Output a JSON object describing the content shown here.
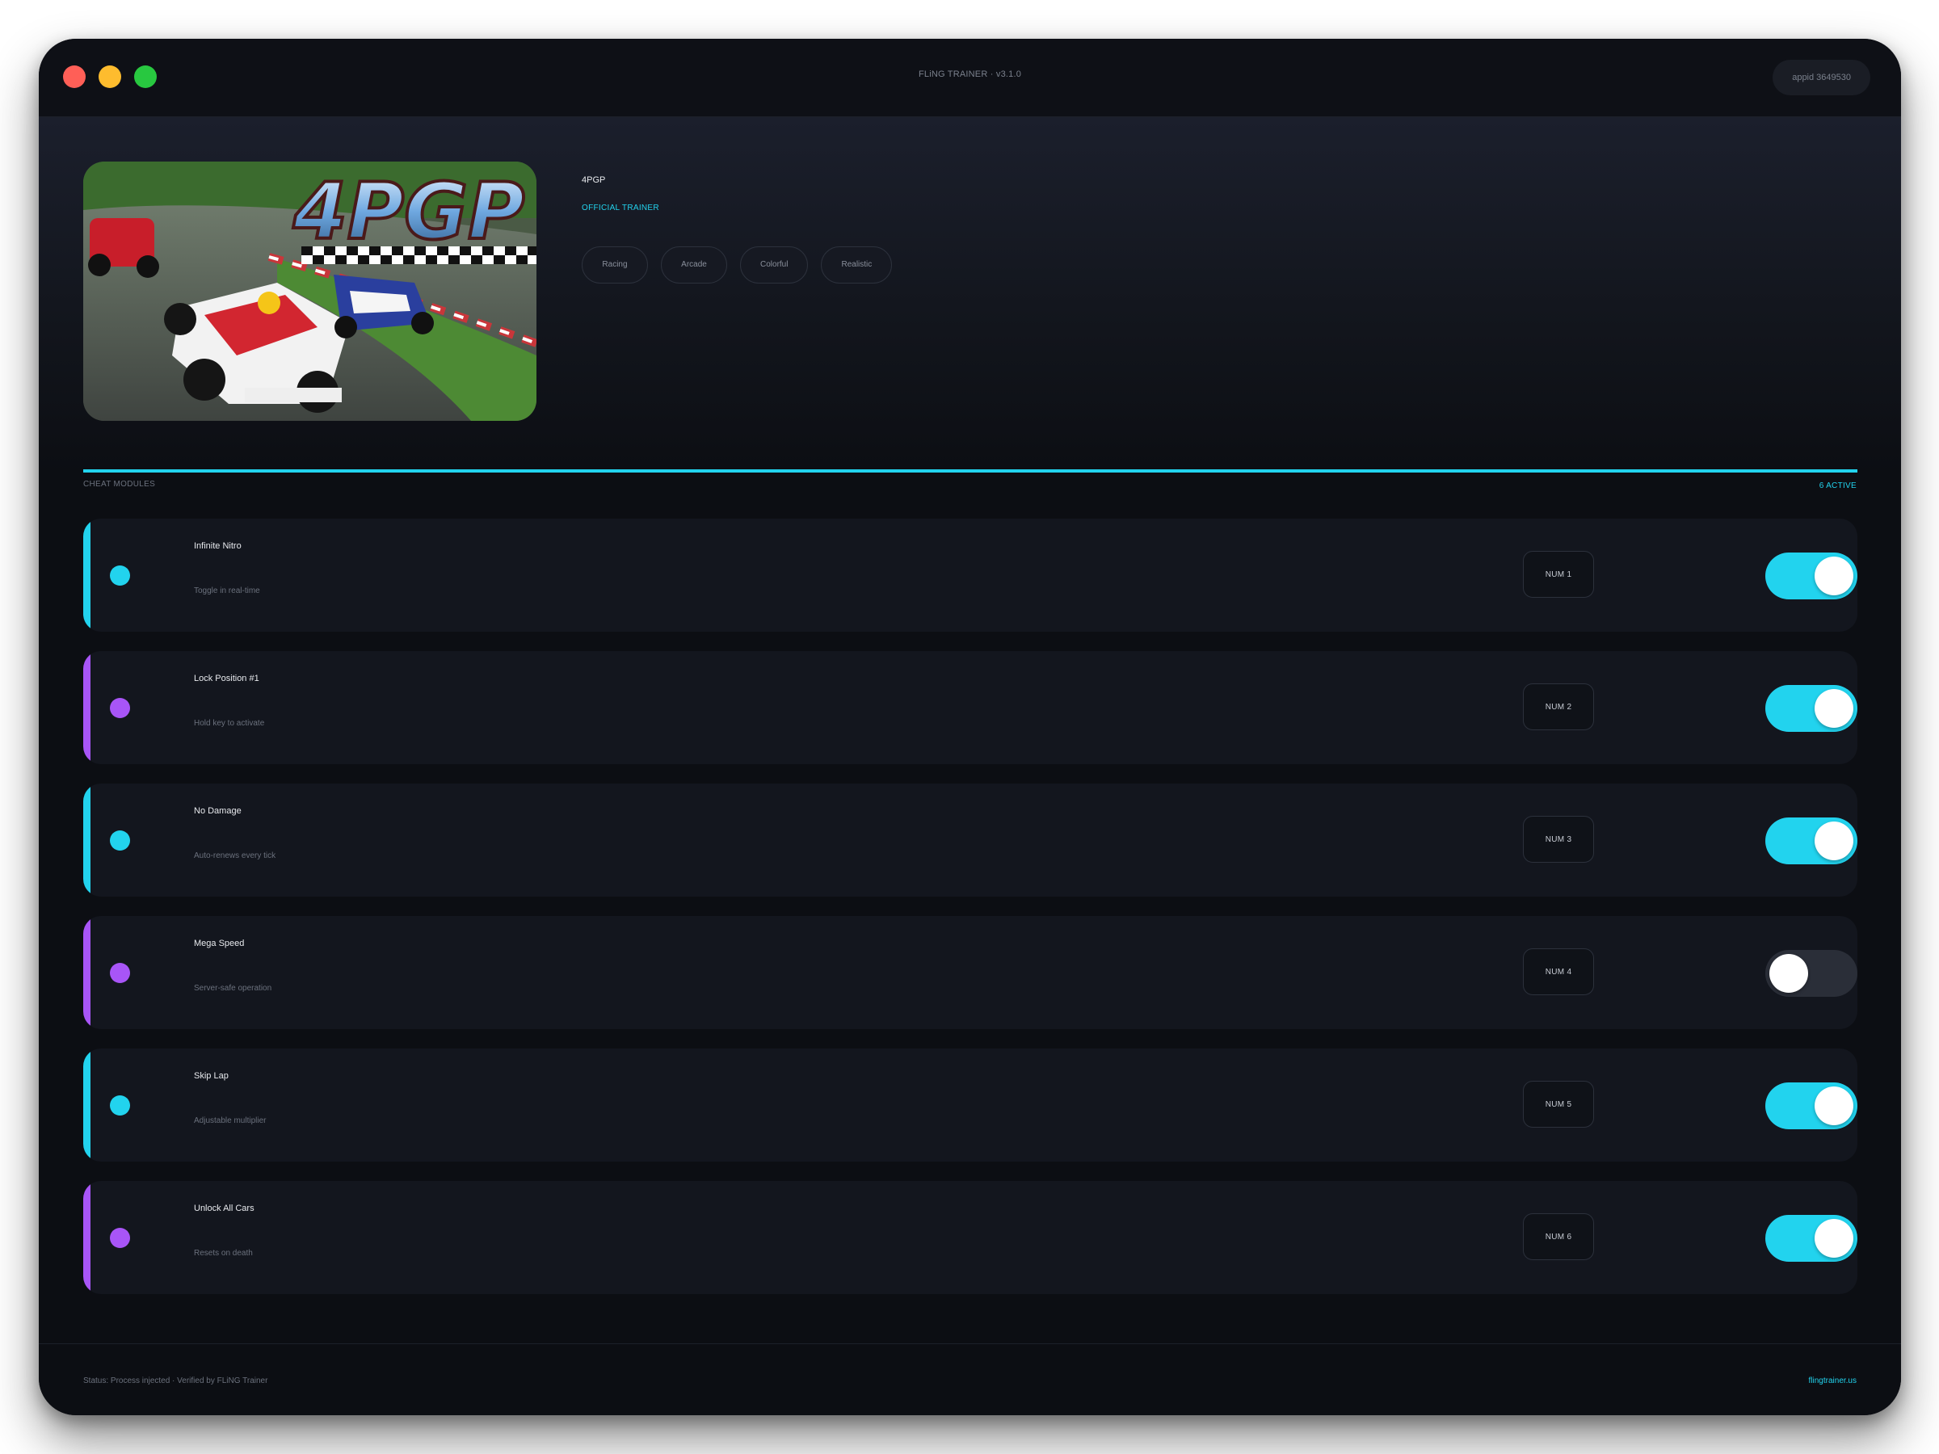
{
  "window": {
    "title": "FLiNG TRAINER · v3.1.0",
    "appid": "appid 3649530"
  },
  "game": {
    "name": "4PGP",
    "cover_logo": "4PGP",
    "badge": "OFFICIAL TRAINER",
    "tags": [
      "Racing",
      "Arcade",
      "Colorful",
      "Realistic"
    ]
  },
  "modules": {
    "label": "CHEAT MODULES",
    "active_count": "6 ACTIVE"
  },
  "cheats": [
    {
      "name": "Infinite Nitro",
      "desc": "Toggle in real-time",
      "hotkey": "NUM 1",
      "on": true,
      "accent": "#22d3ee"
    },
    {
      "name": "Lock Position #1",
      "desc": "Hold key to activate",
      "hotkey": "NUM 2",
      "on": true,
      "accent": "#a855f7"
    },
    {
      "name": "No Damage",
      "desc": "Auto-renews every tick",
      "hotkey": "NUM 3",
      "on": true,
      "accent": "#22d3ee"
    },
    {
      "name": "Mega Speed",
      "desc": "Server-safe operation",
      "hotkey": "NUM 4",
      "on": false,
      "accent": "#a855f7"
    },
    {
      "name": "Skip Lap",
      "desc": "Adjustable multiplier",
      "hotkey": "NUM 5",
      "on": true,
      "accent": "#22d3ee"
    },
    {
      "name": "Unlock All Cars",
      "desc": "Resets on death",
      "hotkey": "NUM 6",
      "on": true,
      "accent": "#a855f7"
    }
  ],
  "footer": {
    "status": "Status: Process injected · Verified by FLiNG Trainer",
    "site": "flingtrainer.us"
  },
  "colors": {
    "accent_cyan": "#22d3ee",
    "accent_purple": "#a855f7",
    "window_bg": "#0c0e13"
  },
  "icons": {
    "close": "close-light",
    "minimize": "minimize-light",
    "maximize": "maximize-light",
    "cheat_status": "status-dot-icon"
  }
}
